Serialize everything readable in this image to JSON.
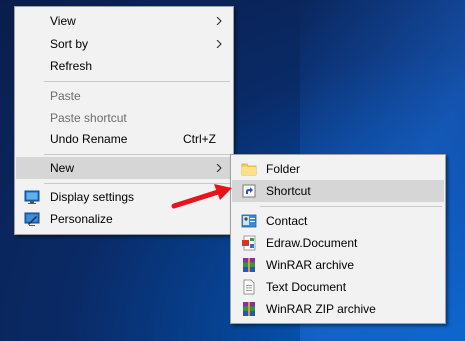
{
  "context_menu": {
    "items": [
      {
        "label": "View",
        "has_submenu": true
      },
      {
        "label": "Sort by",
        "has_submenu": true
      },
      {
        "label": "Refresh"
      },
      {
        "label": "Paste",
        "disabled": true
      },
      {
        "label": "Paste shortcut",
        "disabled": true
      },
      {
        "label": "Undo Rename",
        "shortcut": "Ctrl+Z"
      },
      {
        "label": "New",
        "has_submenu": true,
        "highlighted": true
      },
      {
        "label": "Display settings",
        "icon": "display-icon"
      },
      {
        "label": "Personalize",
        "icon": "personalize-icon"
      }
    ]
  },
  "new_submenu": {
    "items": [
      {
        "label": "Folder",
        "icon": "folder-icon"
      },
      {
        "label": "Shortcut",
        "icon": "shortcut-icon",
        "highlighted": true
      },
      {
        "label": "Contact",
        "icon": "contact-icon"
      },
      {
        "label": "Edraw.Document",
        "icon": "edraw-document-icon"
      },
      {
        "label": "WinRAR archive",
        "icon": "winrar-icon"
      },
      {
        "label": "Text Document",
        "icon": "text-document-icon"
      },
      {
        "label": "WinRAR ZIP archive",
        "icon": "winrar-zip-icon"
      }
    ]
  },
  "colors": {
    "menu_background": "#f2f2f2",
    "highlight": "#d6d6d6",
    "arrow_annotation": "#e8141a"
  }
}
